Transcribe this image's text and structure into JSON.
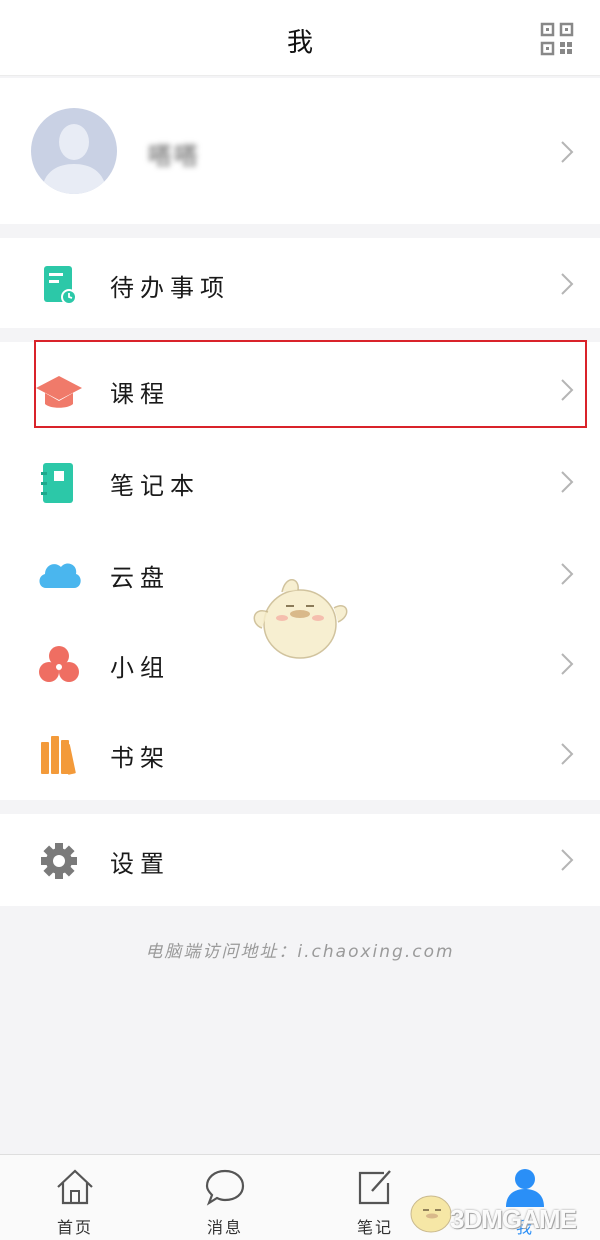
{
  "header": {
    "title": "我"
  },
  "profile": {
    "name": "嗒嗒"
  },
  "menu": {
    "todo": "待办事项",
    "course": "课程",
    "notebook": "笔记本",
    "cloud": "云盘",
    "group": "小组",
    "bookshelf": "书架",
    "settings": "设置"
  },
  "footer_note": "电脑端访问地址：i.chaoxing.com",
  "tabbar": {
    "home": "首页",
    "messages": "消息",
    "notes": "笔记",
    "me": "我"
  },
  "watermark": "3DMGAME",
  "colors": {
    "highlight": "#d9232a",
    "teal": "#2cc8a8",
    "course": "#f07a6a",
    "cloud": "#4ab6ee",
    "group": "#ef6e62",
    "bookshelf": "#f39a3a",
    "active_tab": "#2a8ff7"
  }
}
